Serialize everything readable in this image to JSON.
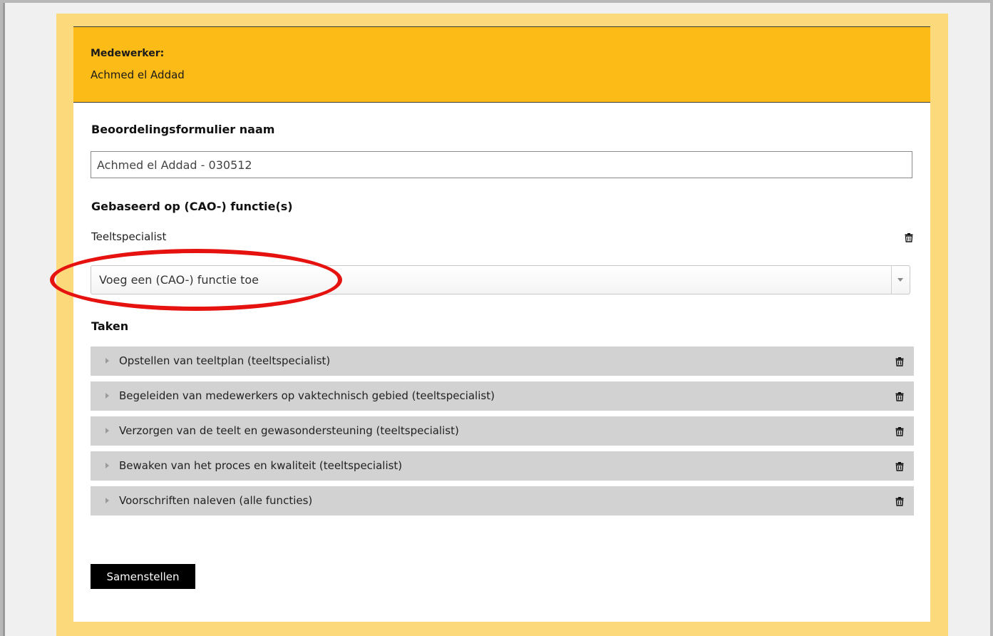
{
  "employee": {
    "label": "Medewerker:",
    "name": "Achmed el Addad"
  },
  "form": {
    "name_heading": "Beoordelingsformulier naam",
    "name_value": "Achmed el Addad - 030512",
    "functions_heading": "Gebaseerd op (CAO-) functie(s)",
    "functions": [
      {
        "label": "Teeltspecialist",
        "icon": "trash-icon"
      }
    ],
    "add_function_placeholder": "Voeg een (CAO-) functie toe",
    "tasks_heading": "Taken",
    "tasks": [
      {
        "label": "Opstellen van teeltplan (teeltspecialist)"
      },
      {
        "label": "Begeleiden van medewerkers op vaktechnisch gebied (teeltspecialist)"
      },
      {
        "label": "Verzorgen van de teelt en gewasondersteuning (teeltspecialist)"
      },
      {
        "label": "Bewaken van het proces en kwaliteit (teeltspecialist)"
      },
      {
        "label": "Voorschriften naleven (alle functies)"
      }
    ],
    "submit_label": "Samenstellen"
  },
  "colors": {
    "header_bg": "#fdbb17",
    "outer_panel_bg": "#fcd97a",
    "task_row_bg": "#d2d2d2",
    "highlight": "#e5120f",
    "button_bg": "#000000"
  }
}
